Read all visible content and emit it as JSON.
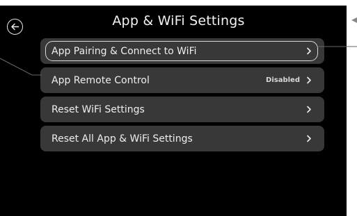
{
  "header": {
    "title": "App & WiFi Settings"
  },
  "menu": {
    "items": [
      {
        "label": "App Pairing & Connect to WiFi",
        "status": ""
      },
      {
        "label": "App Remote Control",
        "status": "Disabled"
      },
      {
        "label": "Reset WiFi Settings",
        "status": ""
      },
      {
        "label": "Reset All App & WiFi Settings",
        "status": ""
      }
    ]
  },
  "colors": {
    "screen_background": "#000000",
    "item_background": "#383838",
    "text": "#eeeeee",
    "callout_line": "#666666"
  },
  "icons": {
    "back": "arrow-left-circle-icon",
    "chevron": "chevron-right-icon"
  }
}
